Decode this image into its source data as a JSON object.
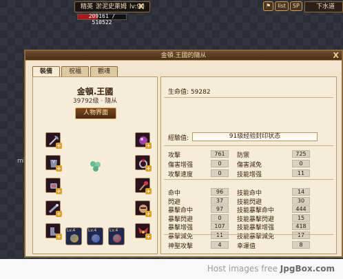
{
  "scene": {
    "nameplate_title": "精英",
    "nameplate_name": "淤泥史萊姆",
    "nameplate_level": "lv:90",
    "close_glyph": "X",
    "hp_text": "209161 / 510522",
    "hp_fraction": 0.41,
    "buttons": [
      "list",
      "SP"
    ],
    "next_button": "下水道",
    "side_text": "mis"
  },
  "window": {
    "title": "金頓.王國的隨从",
    "close_glyph": "X",
    "tabs": [
      "裝備",
      "祝福",
      "觀魂"
    ],
    "character": {
      "name": "金頓.王國",
      "level_line": "39792级 · 隨从",
      "view_button": "人物界面"
    },
    "skills": [
      {
        "lv": "Lv.4",
        "color": "#d8a020"
      },
      {
        "lv": "Lv.4",
        "color": "#3060d0"
      },
      {
        "lv": "Lv.4",
        "color": "#d03030"
      }
    ],
    "hp_label": "生命值:",
    "hp_value": "59282",
    "exp_label": "經驗值:",
    "exp_value": "91级经验封印状态",
    "stats_group1": [
      {
        "l": "攻擊",
        "v": "761",
        "r": "防禦",
        "rv": "725"
      },
      {
        "l": "傷害增强",
        "v": "0",
        "r": "傷害減免",
        "rv": "0"
      },
      {
        "l": "攻擊速度",
        "v": "0",
        "r": "技能增强",
        "rv": "11"
      }
    ],
    "stats_group2": [
      {
        "l": "命中",
        "v": "96",
        "r": "技能命中",
        "rv": "14"
      },
      {
        "l": "閃避",
        "v": "37",
        "r": "技能閃避",
        "rv": "30"
      },
      {
        "l": "暴擊命中",
        "v": "97",
        "r": "技能暴擊命中",
        "rv": "444"
      },
      {
        "l": "暴擊閃避",
        "v": "0",
        "r": "技能暴擊閃避",
        "rv": "15"
      },
      {
        "l": "暴擊增强",
        "v": "107",
        "r": "技能暴擊增强",
        "rv": "418"
      },
      {
        "l": "暴擊減免",
        "v": "11",
        "r": "技能暴擊減免",
        "rv": "17"
      }
    ],
    "stats_group3": [
      {
        "l": "神聖攻擊",
        "v": "4",
        "r": "幸運值",
        "rv": "8"
      }
    ]
  },
  "footer": {
    "prefix": "Host images free",
    "brand": "JpgBox.com"
  }
}
